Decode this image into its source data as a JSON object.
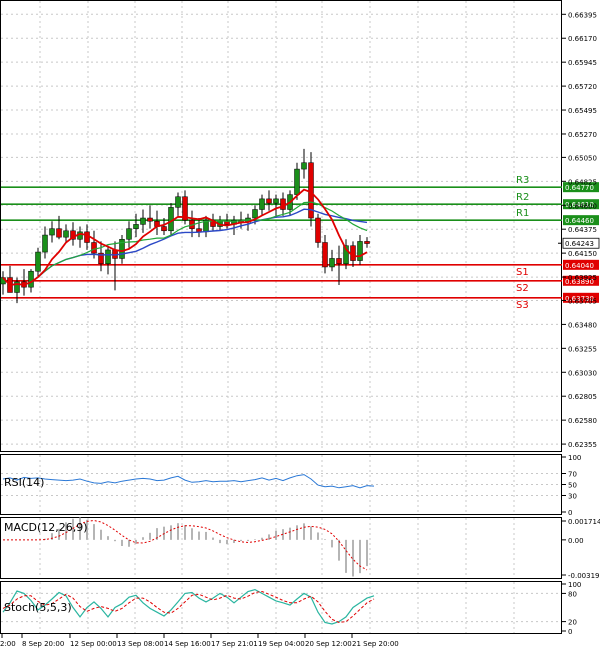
{
  "chart_data": {
    "type": "candlestick",
    "price_panel": {
      "y_ticks": [
        "0.66395",
        "0.66170",
        "0.65945",
        "0.65720",
        "0.65495",
        "0.65270",
        "0.65050",
        "0.64825",
        "0.64600",
        "0.64375",
        "0.64150",
        "0.63925",
        "0.63705",
        "0.63480",
        "0.63255",
        "0.63030",
        "0.62805",
        "0.62580",
        "0.62355"
      ],
      "ylim": [
        0.6229,
        0.6652
      ],
      "current_price": "0.64243",
      "levels": [
        {
          "name": "R3",
          "value": 0.6477,
          "label": "0.64770",
          "color": "#1a8f1a"
        },
        {
          "name": "R2",
          "value": 0.6461,
          "label": "0.64610",
          "color": "#1a8f1a"
        },
        {
          "name": "R1",
          "value": 0.6446,
          "label": "0.64460",
          "color": "#1a8f1a"
        },
        {
          "name": "S1",
          "value": 0.6404,
          "label": "0.64040",
          "color": "#e00000"
        },
        {
          "name": "S2",
          "value": 0.6389,
          "label": "0.63890",
          "color": "#e00000"
        },
        {
          "name": "S3",
          "value": 0.6373,
          "label": "0.63730",
          "color": "#e00000"
        }
      ],
      "candles": [
        {
          "o": 0.6386,
          "h": 0.6398,
          "l": 0.6376,
          "c": 0.6392
        },
        {
          "o": 0.6392,
          "h": 0.6403,
          "l": 0.6385,
          "c": 0.6378
        },
        {
          "o": 0.6378,
          "h": 0.6392,
          "l": 0.6368,
          "c": 0.6388
        },
        {
          "o": 0.6388,
          "h": 0.64,
          "l": 0.6375,
          "c": 0.6383
        },
        {
          "o": 0.6383,
          "h": 0.64,
          "l": 0.6378,
          "c": 0.6398
        },
        {
          "o": 0.6398,
          "h": 0.642,
          "l": 0.6392,
          "c": 0.6416
        },
        {
          "o": 0.6416,
          "h": 0.644,
          "l": 0.641,
          "c": 0.6432
        },
        {
          "o": 0.6432,
          "h": 0.6445,
          "l": 0.6425,
          "c": 0.6438
        },
        {
          "o": 0.6438,
          "h": 0.645,
          "l": 0.6428,
          "c": 0.643
        },
        {
          "o": 0.643,
          "h": 0.6442,
          "l": 0.6424,
          "c": 0.6436
        },
        {
          "o": 0.6436,
          "h": 0.6444,
          "l": 0.6422,
          "c": 0.6428
        },
        {
          "o": 0.6428,
          "h": 0.644,
          "l": 0.642,
          "c": 0.6435
        },
        {
          "o": 0.6435,
          "h": 0.6442,
          "l": 0.6418,
          "c": 0.6425
        },
        {
          "o": 0.6425,
          "h": 0.6436,
          "l": 0.641,
          "c": 0.6415
        },
        {
          "o": 0.6415,
          "h": 0.6426,
          "l": 0.6398,
          "c": 0.6405
        },
        {
          "o": 0.6405,
          "h": 0.6422,
          "l": 0.6395,
          "c": 0.6418
        },
        {
          "o": 0.6418,
          "h": 0.6426,
          "l": 0.638,
          "c": 0.641
        },
        {
          "o": 0.641,
          "h": 0.6432,
          "l": 0.6405,
          "c": 0.6428
        },
        {
          "o": 0.6428,
          "h": 0.6445,
          "l": 0.642,
          "c": 0.6438
        },
        {
          "o": 0.6438,
          "h": 0.6452,
          "l": 0.643,
          "c": 0.6442
        },
        {
          "o": 0.6442,
          "h": 0.6456,
          "l": 0.6434,
          "c": 0.6448
        },
        {
          "o": 0.6448,
          "h": 0.646,
          "l": 0.6438,
          "c": 0.6445
        },
        {
          "o": 0.6445,
          "h": 0.6455,
          "l": 0.6432,
          "c": 0.644
        },
        {
          "o": 0.644,
          "h": 0.6448,
          "l": 0.6432,
          "c": 0.6436
        },
        {
          "o": 0.6436,
          "h": 0.6462,
          "l": 0.6432,
          "c": 0.6458
        },
        {
          "o": 0.6458,
          "h": 0.6472,
          "l": 0.645,
          "c": 0.6468
        },
        {
          "o": 0.6468,
          "h": 0.6474,
          "l": 0.6442,
          "c": 0.6446
        },
        {
          "o": 0.6446,
          "h": 0.6455,
          "l": 0.643,
          "c": 0.6438
        },
        {
          "o": 0.6438,
          "h": 0.6448,
          "l": 0.643,
          "c": 0.6435
        },
        {
          "o": 0.6435,
          "h": 0.645,
          "l": 0.643,
          "c": 0.6446
        },
        {
          "o": 0.6446,
          "h": 0.6452,
          "l": 0.6436,
          "c": 0.644
        },
        {
          "o": 0.644,
          "h": 0.645,
          "l": 0.6436,
          "c": 0.6445
        },
        {
          "o": 0.6445,
          "h": 0.6452,
          "l": 0.6438,
          "c": 0.6442
        },
        {
          "o": 0.6442,
          "h": 0.645,
          "l": 0.6432,
          "c": 0.6446
        },
        {
          "o": 0.6446,
          "h": 0.6454,
          "l": 0.6438,
          "c": 0.6444
        },
        {
          "o": 0.6444,
          "h": 0.6452,
          "l": 0.6436,
          "c": 0.6448
        },
        {
          "o": 0.6448,
          "h": 0.646,
          "l": 0.6442,
          "c": 0.6456
        },
        {
          "o": 0.6456,
          "h": 0.647,
          "l": 0.645,
          "c": 0.6466
        },
        {
          "o": 0.6466,
          "h": 0.6474,
          "l": 0.6455,
          "c": 0.6462
        },
        {
          "o": 0.6462,
          "h": 0.647,
          "l": 0.6448,
          "c": 0.6466
        },
        {
          "o": 0.6466,
          "h": 0.6472,
          "l": 0.645,
          "c": 0.6456
        },
        {
          "o": 0.6456,
          "h": 0.6474,
          "l": 0.645,
          "c": 0.647
        },
        {
          "o": 0.647,
          "h": 0.65,
          "l": 0.6465,
          "c": 0.6494
        },
        {
          "o": 0.6494,
          "h": 0.6513,
          "l": 0.6485,
          "c": 0.65
        },
        {
          "o": 0.65,
          "h": 0.651,
          "l": 0.644,
          "c": 0.6448
        },
        {
          "o": 0.6448,
          "h": 0.6452,
          "l": 0.642,
          "c": 0.6425
        },
        {
          "o": 0.6425,
          "h": 0.6432,
          "l": 0.6396,
          "c": 0.6402
        },
        {
          "o": 0.6402,
          "h": 0.6418,
          "l": 0.6398,
          "c": 0.641
        },
        {
          "o": 0.641,
          "h": 0.6422,
          "l": 0.6385,
          "c": 0.6405
        },
        {
          "o": 0.6405,
          "h": 0.6428,
          "l": 0.64,
          "c": 0.6422
        },
        {
          "o": 0.6422,
          "h": 0.6426,
          "l": 0.6402,
          "c": 0.6408
        },
        {
          "o": 0.6408,
          "h": 0.6432,
          "l": 0.6404,
          "c": 0.6426
        },
        {
          "o": 0.6426,
          "h": 0.643,
          "l": 0.642,
          "c": 0.6424
        }
      ]
    },
    "rsi": {
      "label": "RSI(14)",
      "y_ticks": [
        "100",
        "70",
        "50",
        "30",
        "0"
      ],
      "values": [
        60,
        62,
        58,
        63,
        61,
        62,
        60,
        59,
        58,
        57,
        58,
        60,
        56,
        53,
        52,
        55,
        53,
        56,
        58,
        60,
        61,
        60,
        57,
        58,
        62,
        65,
        58,
        54,
        55,
        57,
        55,
        56,
        56,
        57,
        55,
        57,
        59,
        62,
        58,
        61,
        57,
        62,
        66,
        68,
        60,
        49,
        46,
        47,
        44,
        46,
        48,
        44,
        48,
        47
      ]
    },
    "macd": {
      "label": "MACD(12,26,9)",
      "y_ticks": [
        "0.001714",
        "0.00",
        "-0.003195"
      ]
    },
    "stoch": {
      "label": "Stoch(5,5,3)",
      "y_ticks": [
        "100",
        "80",
        "20",
        "0"
      ],
      "k": [
        40,
        60,
        85,
        80,
        65,
        45,
        55,
        68,
        82,
        75,
        50,
        30,
        50,
        62,
        48,
        30,
        50,
        58,
        72,
        76,
        60,
        48,
        40,
        32,
        45,
        62,
        80,
        82,
        70,
        62,
        70,
        80,
        72,
        60,
        72,
        84,
        88,
        80,
        72,
        64,
        60,
        55,
        68,
        80,
        72,
        40,
        18,
        15,
        20,
        30,
        50,
        60,
        70,
        75
      ],
      "d": [
        48,
        55,
        68,
        75,
        75,
        63,
        55,
        58,
        68,
        78,
        70,
        52,
        42,
        48,
        52,
        48,
        42,
        48,
        60,
        70,
        70,
        62,
        50,
        40,
        38,
        48,
        62,
        76,
        78,
        72,
        66,
        70,
        76,
        70,
        68,
        74,
        82,
        84,
        78,
        72,
        65,
        60,
        60,
        68,
        74,
        62,
        42,
        25,
        18,
        20,
        32,
        46,
        60,
        68
      ]
    },
    "x_labels": [
      "2:00",
      "8 Sep 20:00",
      "12 Sep 00:00",
      "13 Sep 08:00",
      "14 Sep 16:00",
      "17 Sep 21:01",
      "19 Sep 04:00",
      "20 Sep 12:00",
      "21 Sep 20:00"
    ]
  }
}
